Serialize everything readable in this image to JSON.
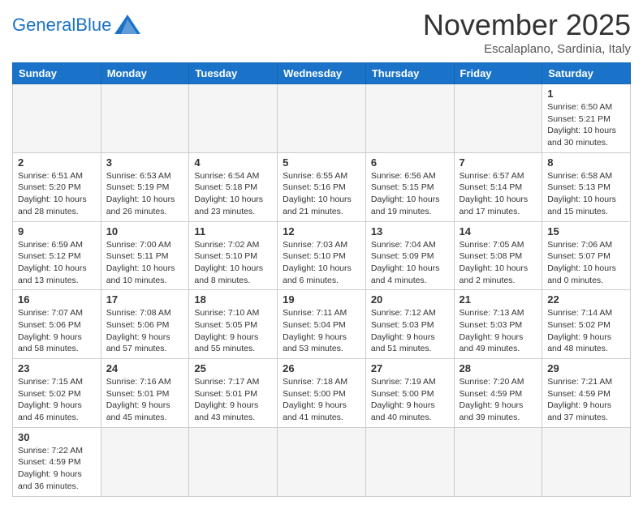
{
  "header": {
    "logo_general": "General",
    "logo_blue": "Blue",
    "month_title": "November 2025",
    "subtitle": "Escalaplano, Sardinia, Italy"
  },
  "days_of_week": [
    "Sunday",
    "Monday",
    "Tuesday",
    "Wednesday",
    "Thursday",
    "Friday",
    "Saturday"
  ],
  "weeks": [
    [
      {
        "day": "",
        "info": ""
      },
      {
        "day": "",
        "info": ""
      },
      {
        "day": "",
        "info": ""
      },
      {
        "day": "",
        "info": ""
      },
      {
        "day": "",
        "info": ""
      },
      {
        "day": "",
        "info": ""
      },
      {
        "day": "1",
        "info": "Sunrise: 6:50 AM\nSunset: 5:21 PM\nDaylight: 10 hours and 30 minutes."
      }
    ],
    [
      {
        "day": "2",
        "info": "Sunrise: 6:51 AM\nSunset: 5:20 PM\nDaylight: 10 hours and 28 minutes."
      },
      {
        "day": "3",
        "info": "Sunrise: 6:53 AM\nSunset: 5:19 PM\nDaylight: 10 hours and 26 minutes."
      },
      {
        "day": "4",
        "info": "Sunrise: 6:54 AM\nSunset: 5:18 PM\nDaylight: 10 hours and 23 minutes."
      },
      {
        "day": "5",
        "info": "Sunrise: 6:55 AM\nSunset: 5:16 PM\nDaylight: 10 hours and 21 minutes."
      },
      {
        "day": "6",
        "info": "Sunrise: 6:56 AM\nSunset: 5:15 PM\nDaylight: 10 hours and 19 minutes."
      },
      {
        "day": "7",
        "info": "Sunrise: 6:57 AM\nSunset: 5:14 PM\nDaylight: 10 hours and 17 minutes."
      },
      {
        "day": "8",
        "info": "Sunrise: 6:58 AM\nSunset: 5:13 PM\nDaylight: 10 hours and 15 minutes."
      }
    ],
    [
      {
        "day": "9",
        "info": "Sunrise: 6:59 AM\nSunset: 5:12 PM\nDaylight: 10 hours and 13 minutes."
      },
      {
        "day": "10",
        "info": "Sunrise: 7:00 AM\nSunset: 5:11 PM\nDaylight: 10 hours and 10 minutes."
      },
      {
        "day": "11",
        "info": "Sunrise: 7:02 AM\nSunset: 5:10 PM\nDaylight: 10 hours and 8 minutes."
      },
      {
        "day": "12",
        "info": "Sunrise: 7:03 AM\nSunset: 5:10 PM\nDaylight: 10 hours and 6 minutes."
      },
      {
        "day": "13",
        "info": "Sunrise: 7:04 AM\nSunset: 5:09 PM\nDaylight: 10 hours and 4 minutes."
      },
      {
        "day": "14",
        "info": "Sunrise: 7:05 AM\nSunset: 5:08 PM\nDaylight: 10 hours and 2 minutes."
      },
      {
        "day": "15",
        "info": "Sunrise: 7:06 AM\nSunset: 5:07 PM\nDaylight: 10 hours and 0 minutes."
      }
    ],
    [
      {
        "day": "16",
        "info": "Sunrise: 7:07 AM\nSunset: 5:06 PM\nDaylight: 9 hours and 58 minutes."
      },
      {
        "day": "17",
        "info": "Sunrise: 7:08 AM\nSunset: 5:06 PM\nDaylight: 9 hours and 57 minutes."
      },
      {
        "day": "18",
        "info": "Sunrise: 7:10 AM\nSunset: 5:05 PM\nDaylight: 9 hours and 55 minutes."
      },
      {
        "day": "19",
        "info": "Sunrise: 7:11 AM\nSunset: 5:04 PM\nDaylight: 9 hours and 53 minutes."
      },
      {
        "day": "20",
        "info": "Sunrise: 7:12 AM\nSunset: 5:03 PM\nDaylight: 9 hours and 51 minutes."
      },
      {
        "day": "21",
        "info": "Sunrise: 7:13 AM\nSunset: 5:03 PM\nDaylight: 9 hours and 49 minutes."
      },
      {
        "day": "22",
        "info": "Sunrise: 7:14 AM\nSunset: 5:02 PM\nDaylight: 9 hours and 48 minutes."
      }
    ],
    [
      {
        "day": "23",
        "info": "Sunrise: 7:15 AM\nSunset: 5:02 PM\nDaylight: 9 hours and 46 minutes."
      },
      {
        "day": "24",
        "info": "Sunrise: 7:16 AM\nSunset: 5:01 PM\nDaylight: 9 hours and 45 minutes."
      },
      {
        "day": "25",
        "info": "Sunrise: 7:17 AM\nSunset: 5:01 PM\nDaylight: 9 hours and 43 minutes."
      },
      {
        "day": "26",
        "info": "Sunrise: 7:18 AM\nSunset: 5:00 PM\nDaylight: 9 hours and 41 minutes."
      },
      {
        "day": "27",
        "info": "Sunrise: 7:19 AM\nSunset: 5:00 PM\nDaylight: 9 hours and 40 minutes."
      },
      {
        "day": "28",
        "info": "Sunrise: 7:20 AM\nSunset: 4:59 PM\nDaylight: 9 hours and 39 minutes."
      },
      {
        "day": "29",
        "info": "Sunrise: 7:21 AM\nSunset: 4:59 PM\nDaylight: 9 hours and 37 minutes."
      }
    ],
    [
      {
        "day": "30",
        "info": "Sunrise: 7:22 AM\nSunset: 4:59 PM\nDaylight: 9 hours and 36 minutes."
      },
      {
        "day": "",
        "info": ""
      },
      {
        "day": "",
        "info": ""
      },
      {
        "day": "",
        "info": ""
      },
      {
        "day": "",
        "info": ""
      },
      {
        "day": "",
        "info": ""
      },
      {
        "day": "",
        "info": ""
      }
    ]
  ]
}
